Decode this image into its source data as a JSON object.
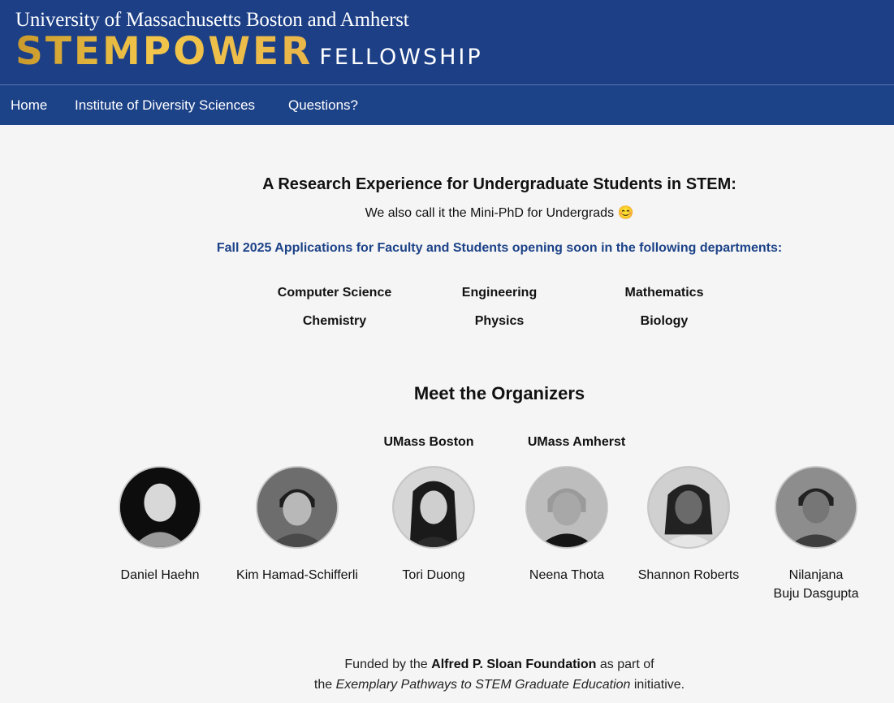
{
  "header": {
    "university": "University of Massachusetts Boston and Amherst",
    "brand_main": "STEMPOWER",
    "brand_sub": "FELLOWSHIP"
  },
  "nav": {
    "items": [
      "Home",
      "Institute of Diversity Sciences",
      "Questions?"
    ]
  },
  "main": {
    "headline": "A Research Experience for Undergraduate Students in STEM:",
    "tagline": "We also call it the Mini-PhD for Undergrads 😊",
    "notice": "Fall 2025 Applications for Faculty and Students opening soon in the following departments:",
    "departments": [
      "Computer Science",
      "Engineering",
      "Mathematics",
      "Chemistry",
      "Physics",
      "Biology"
    ]
  },
  "organizers": {
    "title": "Meet the Organizers",
    "campuses": [
      "UMass Boston",
      "UMass Amherst"
    ],
    "people": [
      {
        "name": "Daniel Haehn"
      },
      {
        "name": "Kim Hamad-Schifferli"
      },
      {
        "name": "Tori Duong"
      },
      {
        "name": "Neena Thota"
      },
      {
        "name": "Shannon Roberts"
      },
      {
        "name_line1": "Nilanjana",
        "name_line2": "Buju Dasgupta"
      }
    ]
  },
  "footer": {
    "prefix": "Funded by the",
    "sponsor": "Alfred P. Sloan Foundation",
    "middle": "as part of",
    "line2_prefix": "the",
    "initiative": "Exemplary Pathways to STEM Graduate Education",
    "suffix": "initiative."
  },
  "colors": {
    "banner": "#1c3f86",
    "nav": "#1c4288",
    "accent_gold": "#f2c64a",
    "notice_blue": "#1c4288"
  }
}
